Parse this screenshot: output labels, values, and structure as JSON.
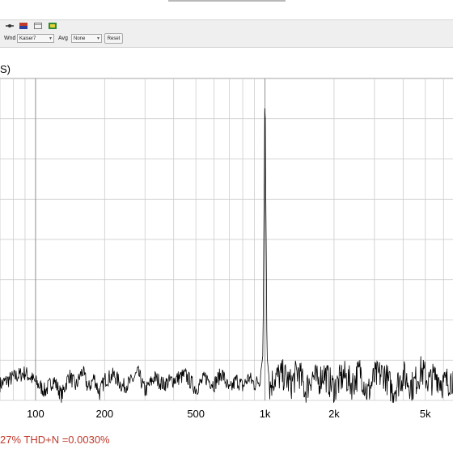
{
  "toolbar": {
    "icons": [
      "line-color-icon",
      "palette-icon",
      "window-icon",
      "export-icon"
    ],
    "window_label": "Wnd",
    "window_value": "Kaiser7",
    "avg_label": "Avg",
    "avg_value": "None",
    "reset_label": "Reset"
  },
  "plot": {
    "ylabel_fragment": "S)",
    "status_text": "27% THD+N =0.0030%"
  },
  "chart_data": {
    "type": "line",
    "x_scale": "log",
    "xlim": [
      70,
      6600
    ],
    "x_ticks": [
      {
        "value": 100,
        "label": "100"
      },
      {
        "value": 200,
        "label": "200"
      },
      {
        "value": 500,
        "label": "500"
      },
      {
        "value": 1000,
        "label": "1k"
      },
      {
        "value": 2000,
        "label": "2k"
      },
      {
        "value": 5000,
        "label": "5k"
      }
    ],
    "grid": true,
    "series": [
      {
        "x": [
          70,
          80,
          90,
          100,
          110,
          120,
          130,
          140,
          150,
          160,
          170,
          180,
          190,
          200,
          220,
          240,
          260,
          280,
          300,
          330,
          360,
          400,
          450,
          500,
          550,
          600,
          650,
          700,
          750,
          800,
          850,
          900,
          950,
          980,
          990,
          1000,
          1010,
          1020,
          1050,
          1100,
          1200,
          1300,
          1400,
          1500,
          1600,
          1700,
          1800,
          2000,
          2200,
          2400,
          2600,
          2800,
          3000,
          3300,
          3600,
          4000,
          4400,
          4800,
          5200,
          5600,
          6000,
          6600
        ],
        "y": [
          -133,
          -130,
          -128,
          -132,
          -136,
          -131,
          -138,
          -129,
          -134,
          -127,
          -135,
          -130,
          -137,
          -131,
          -129,
          -134,
          -132,
          -128,
          -136,
          -130,
          -133,
          -131,
          -129,
          -135,
          -130,
          -133,
          -128,
          -136,
          -131,
          -134,
          -130,
          -133,
          -131,
          -120,
          -60,
          0,
          -60,
          -120,
          -134,
          -130,
          -129,
          -133,
          -127,
          -136,
          -129,
          -132,
          -128,
          -135,
          -129,
          -133,
          -127,
          -137,
          -130,
          -128,
          -136,
          -129,
          -134,
          -127,
          -132,
          -129,
          -133,
          -130
        ]
      }
    ],
    "ylim": [
      -140,
      0
    ]
  }
}
